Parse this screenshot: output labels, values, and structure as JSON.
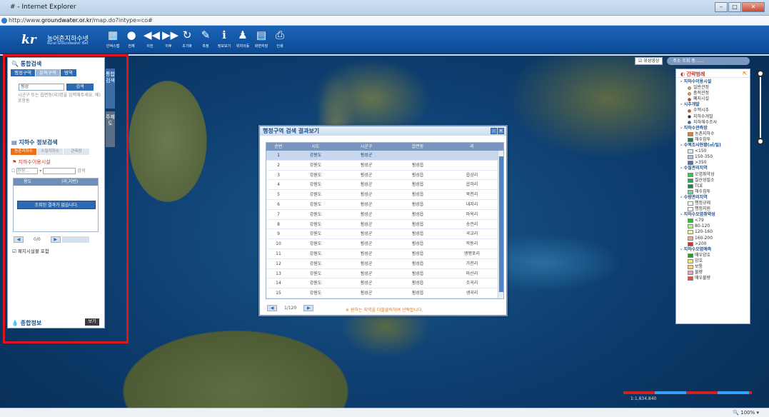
{
  "browser": {
    "title": "# - Internet Explorer",
    "url_prefix": "http://www.",
    "url_host": "groundwater.or.kr",
    "url_path": "/map.do?intype=co#",
    "zoom": "100%"
  },
  "header": {
    "logo_short": "kr",
    "logo_name": "농어촌지하수넷",
    "logo_en": "Rural Groundwater Net",
    "tools": [
      {
        "icon": "print-map-icon",
        "glyph": "▦",
        "label": "인덱스맵"
      },
      {
        "icon": "globe-icon",
        "glyph": "●",
        "label": "전체"
      },
      {
        "icon": "rewind-icon",
        "glyph": "◀◀",
        "label": "이전"
      },
      {
        "icon": "forward-icon",
        "glyph": "▶▶",
        "label": "이후"
      },
      {
        "icon": "refresh-icon",
        "glyph": "↻",
        "label": "초기화"
      },
      {
        "icon": "ruler-icon",
        "glyph": "✎",
        "label": "측정"
      },
      {
        "icon": "info-icon",
        "glyph": "ℹ",
        "label": "정보보기"
      },
      {
        "icon": "pin-icon",
        "glyph": "♟",
        "label": "위치이동"
      },
      {
        "icon": "save-icon",
        "glyph": "▤",
        "label": "화면저장"
      },
      {
        "icon": "printer-icon",
        "glyph": "⎙",
        "label": "인쇄"
      }
    ]
  },
  "left_panel": {
    "search_title": "통합검색",
    "tabs": [
      "행정구역",
      "유역구역",
      "영역"
    ],
    "search_value": "횡성",
    "search_button": "검색",
    "hint": "시군구 또는 읍면동(리)명을 입력해주세요. 예) 포항동",
    "vertical_tab_1": "통합검색",
    "vertical_tab_2": "주제도",
    "info_title": "지하수 정보검색",
    "filter_tabs": [
      "농촌지하수",
      "수질지하수",
      "관측망"
    ],
    "facility_label": "지하수이용시설",
    "facility_select": "현장...",
    "facility_button": "검색",
    "grid_headers": [
      "용도",
      "(리,지번)"
    ],
    "no_result": "조회된 결과가 없습니다.",
    "pager_text": "0/0",
    "include_closed": "폐지시설물 포함",
    "bottom_title": "종합정보",
    "bottom_button": "보기"
  },
  "dialog": {
    "title": "행정구역 검색 결과보기",
    "headers": [
      "순번",
      "시도",
      "시군구",
      "읍면동",
      "리"
    ],
    "rows": [
      [
        "1",
        "강원도",
        "횡성군",
        "",
        ""
      ],
      [
        "2",
        "강원도",
        "횡성군",
        "횡성읍",
        ""
      ],
      [
        "3",
        "강원도",
        "횡성군",
        "횡성읍",
        "읍상리"
      ],
      [
        "4",
        "강원도",
        "횡성군",
        "횡성읍",
        "읍하리"
      ],
      [
        "5",
        "강원도",
        "횡성군",
        "횡성읍",
        "북천리"
      ],
      [
        "6",
        "강원도",
        "횡성군",
        "횡성읍",
        "내지리"
      ],
      [
        "7",
        "강원도",
        "횡성군",
        "횡성읍",
        "마옥리"
      ],
      [
        "8",
        "강원도",
        "횡성군",
        "횡성읍",
        "송전리"
      ],
      [
        "9",
        "강원도",
        "횡성군",
        "횡성읍",
        "곡교리"
      ],
      [
        "10",
        "강원도",
        "횡성군",
        "횡성읍",
        "학동리"
      ],
      [
        "11",
        "강원도",
        "횡성군",
        "횡성읍",
        "앵평포리"
      ],
      [
        "12",
        "강원도",
        "횡성군",
        "횡성읍",
        "가천리"
      ],
      [
        "13",
        "강원도",
        "횡성군",
        "횡성읍",
        "마산리"
      ],
      [
        "14",
        "강원도",
        "횡성군",
        "횡성읍",
        "조곡리"
      ],
      [
        "15",
        "강원도",
        "횡성군",
        "횡성읍",
        "생곡리"
      ]
    ],
    "pager_text": "1/120",
    "message": "※ 원하는 지역을 더블클릭하여 선택합니다."
  },
  "topright": {
    "satellite_label": "위성영상",
    "address_search": "주소 조회 중......"
  },
  "legend": {
    "title": "간략범례",
    "sections": [
      {
        "title": "지하수이용시설",
        "items": [
          {
            "label": "일반관정",
            "kind": "dot",
            "color": "#e8a23a"
          },
          {
            "label": "충적관정",
            "kind": "dot",
            "color": "#e8a23a"
          },
          {
            "label": "폐지시설",
            "kind": "dot",
            "color": "#c0392b"
          }
        ]
      },
      {
        "title": "시추개발",
        "items": [
          {
            "label": "수맥시추",
            "kind": "dot",
            "color": "#d35400"
          },
          {
            "label": "지하수개발",
            "kind": "dot",
            "color": "#222222"
          },
          {
            "label": "지하해수조사",
            "kind": "dot",
            "color": "#2d6ab0"
          }
        ]
      },
      {
        "title": "지하수관측망",
        "items": [
          {
            "label": "농촌지하수",
            "kind": "sw",
            "color": "#e67e22"
          },
          {
            "label": "해수침투",
            "kind": "sw",
            "color": "#1e8449"
          }
        ]
      },
      {
        "title": "수맥조사현황(㎥/일)",
        "items": [
          {
            "label": "<150",
            "kind": "sw",
            "color": "#d6eaf8"
          },
          {
            "label": "150-350",
            "kind": "sw",
            "color": "#a9c4e8"
          },
          {
            "label": ">350",
            "kind": "sw",
            "color": "#5b6fb5"
          }
        ]
      },
      {
        "title": "수질관리지역",
        "items": [
          {
            "label": "오염취약성",
            "kind": "sw",
            "color": "#2ecc40"
          },
          {
            "label": "질산성질소",
            "kind": "sw",
            "color": "#26a65b"
          },
          {
            "label": "TCE",
            "kind": "sw",
            "color": "#1e8449"
          },
          {
            "label": "해수침투",
            "kind": "sw",
            "color": "#7dcea0"
          }
        ]
      },
      {
        "title": "수량관리지역",
        "items": [
          {
            "label": "행정규제",
            "kind": "sw",
            "color": "#ffffff"
          },
          {
            "label": "행정지원",
            "kind": "sw",
            "color": "#ffffff"
          }
        ]
      },
      {
        "title": "지하수오염취약성",
        "items": [
          {
            "label": "<79",
            "kind": "sw",
            "color": "#22c522"
          },
          {
            "label": "80-120",
            "kind": "sw",
            "color": "#b9f08a"
          },
          {
            "label": "120-160",
            "kind": "sw",
            "color": "#f4f48c"
          },
          {
            "label": "160-200",
            "kind": "sw",
            "color": "#f4a6a6"
          },
          {
            "label": ">200",
            "kind": "sw",
            "color": "#d32f2f"
          }
        ]
      },
      {
        "title": "지하수오염예측",
        "items": [
          {
            "label": "매우양호",
            "kind": "sw",
            "color": "#1fa31f"
          },
          {
            "label": "양호",
            "kind": "sw",
            "color": "#e8f06a"
          },
          {
            "label": "보통",
            "kind": "sw",
            "color": "#f5d76e"
          },
          {
            "label": "불량",
            "kind": "sw",
            "color": "#f19ec2"
          },
          {
            "label": "매우불량",
            "kind": "sw",
            "color": "#e74c3c"
          }
        ]
      }
    ]
  },
  "map": {
    "scale_label": "1:1,834,840"
  }
}
